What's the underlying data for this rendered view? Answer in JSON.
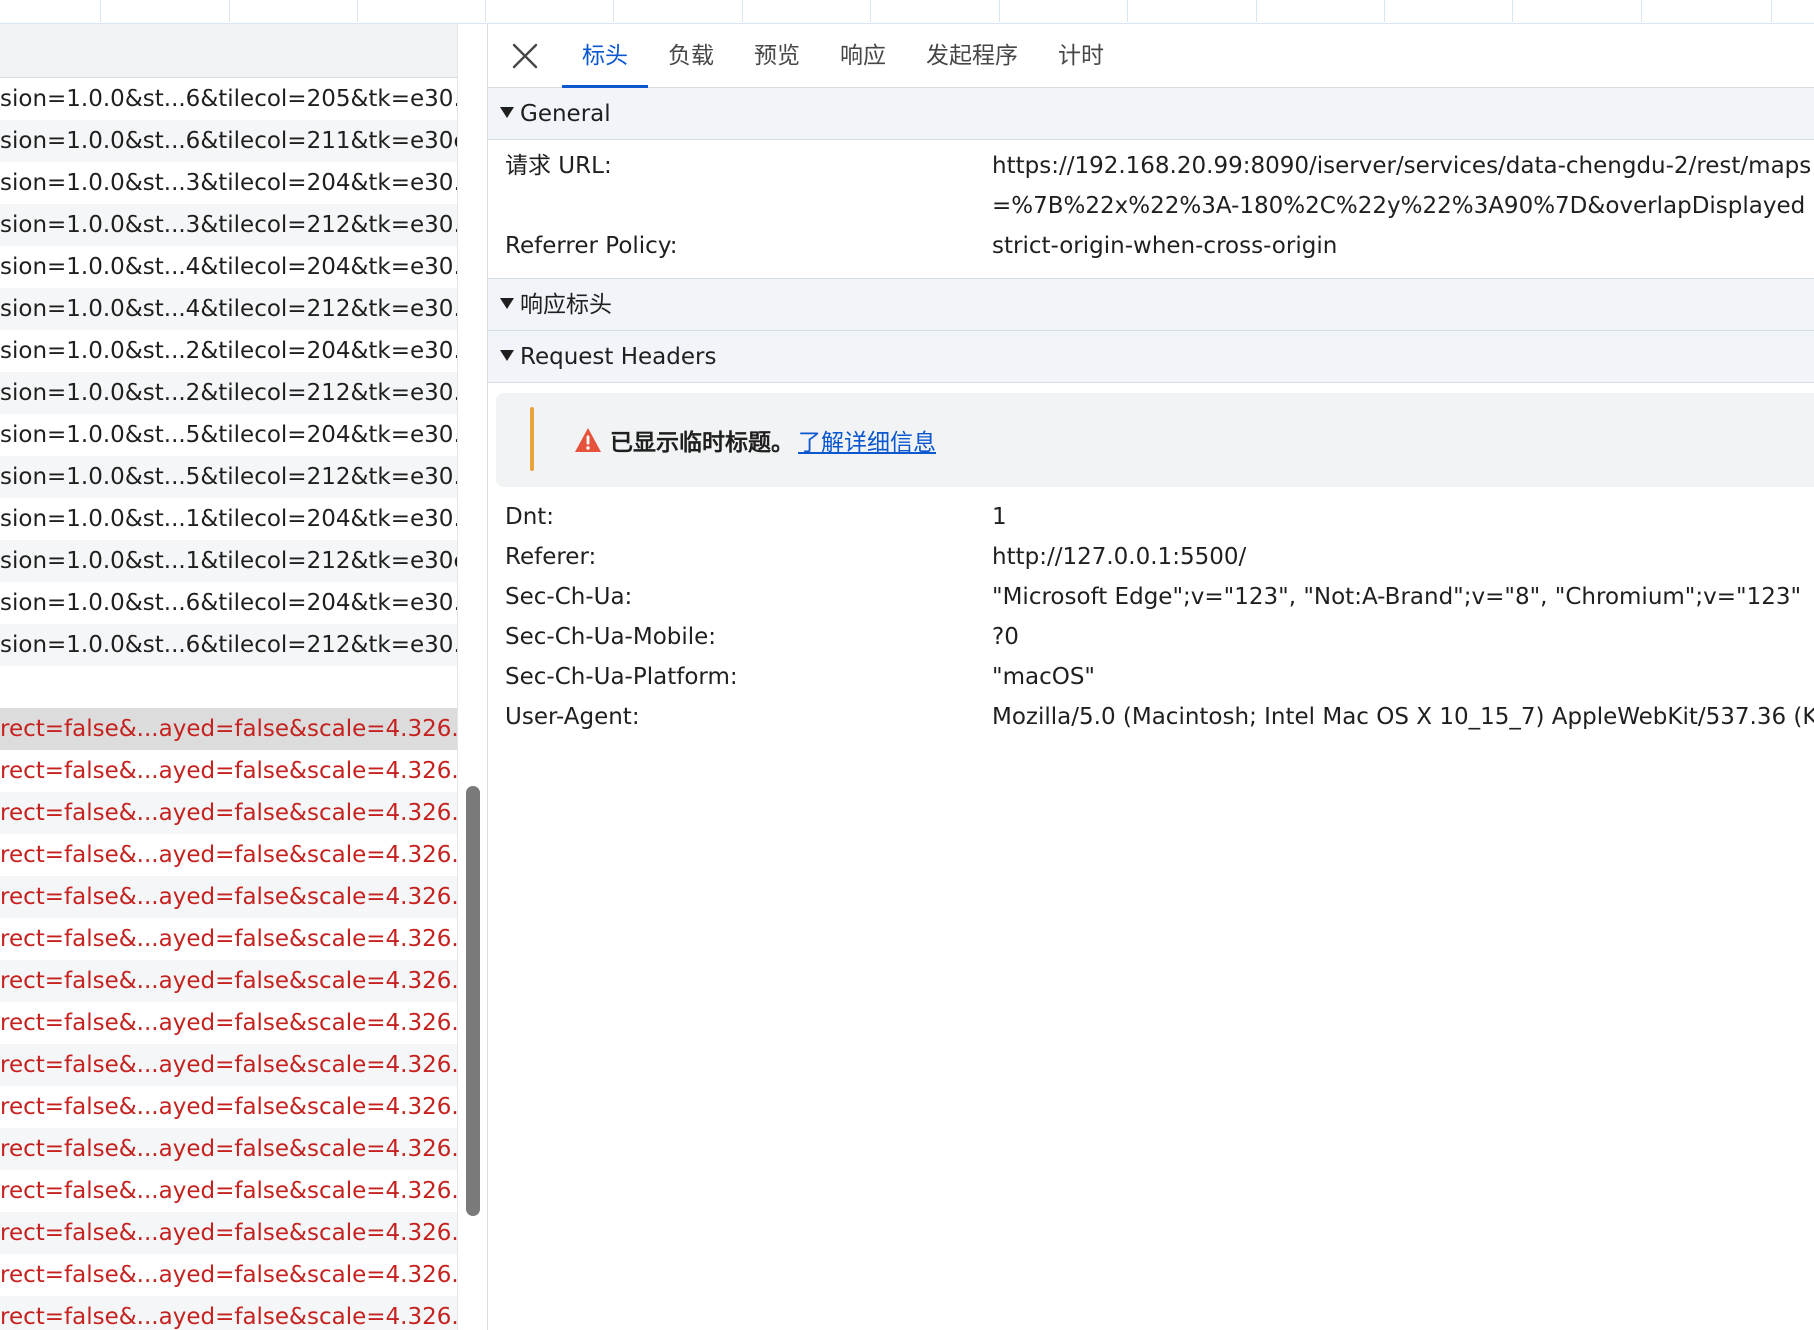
{
  "request_list": {
    "rows": [
      {
        "text": "sion=1.0.0&st...6&tilecol=205&tk=e30...",
        "error": false
      },
      {
        "text": "sion=1.0.0&st...6&tilecol=211&tk=e30c...",
        "error": false
      },
      {
        "text": "sion=1.0.0&st...3&tilecol=204&tk=e30...",
        "error": false
      },
      {
        "text": "sion=1.0.0&st...3&tilecol=212&tk=e30...",
        "error": false
      },
      {
        "text": "sion=1.0.0&st...4&tilecol=204&tk=e30...",
        "error": false
      },
      {
        "text": "sion=1.0.0&st...4&tilecol=212&tk=e30...",
        "error": false
      },
      {
        "text": "sion=1.0.0&st...2&tilecol=204&tk=e30...",
        "error": false
      },
      {
        "text": "sion=1.0.0&st...2&tilecol=212&tk=e30...",
        "error": false
      },
      {
        "text": "sion=1.0.0&st...5&tilecol=204&tk=e30...",
        "error": false
      },
      {
        "text": "sion=1.0.0&st...5&tilecol=212&tk=e30...",
        "error": false
      },
      {
        "text": "sion=1.0.0&st...1&tilecol=204&tk=e30...",
        "error": false
      },
      {
        "text": "sion=1.0.0&st...1&tilecol=212&tk=e30c...",
        "error": false
      },
      {
        "text": "sion=1.0.0&st...6&tilecol=204&tk=e30...",
        "error": false
      },
      {
        "text": "sion=1.0.0&st...6&tilecol=212&tk=e30...",
        "error": false
      },
      {
        "text": "",
        "error": false
      },
      {
        "text": "rect=false&...ayed=false&scale=4.326...",
        "error": true,
        "selected": true
      },
      {
        "text": "rect=false&...ayed=false&scale=4.326...",
        "error": true
      },
      {
        "text": "rect=false&...ayed=false&scale=4.326...",
        "error": true
      },
      {
        "text": "rect=false&...ayed=false&scale=4.326...",
        "error": true
      },
      {
        "text": "rect=false&...ayed=false&scale=4.326...",
        "error": true
      },
      {
        "text": "rect=false&...ayed=false&scale=4.326...",
        "error": true
      },
      {
        "text": "rect=false&...ayed=false&scale=4.326...",
        "error": true
      },
      {
        "text": "rect=false&...ayed=false&scale=4.326...",
        "error": true
      },
      {
        "text": "rect=false&...ayed=false&scale=4.326...",
        "error": true
      },
      {
        "text": "rect=false&...ayed=false&scale=4.326...",
        "error": true
      },
      {
        "text": "rect=false&...ayed=false&scale=4.326...",
        "error": true
      },
      {
        "text": "rect=false&...ayed=false&scale=4.326...",
        "error": true
      },
      {
        "text": "rect=false&...ayed=false&scale=4.326...",
        "error": true
      },
      {
        "text": "rect=false&...ayed=false&scale=4.326...",
        "error": true
      },
      {
        "text": "rect=false&...ayed=false&scale=4.326...",
        "error": true
      }
    ]
  },
  "tabs": [
    {
      "label": "标头",
      "active": true
    },
    {
      "label": "负载",
      "active": false
    },
    {
      "label": "预览",
      "active": false
    },
    {
      "label": "响应",
      "active": false
    },
    {
      "label": "发起程序",
      "active": false
    },
    {
      "label": "计时",
      "active": false
    }
  ],
  "general": {
    "title": "General",
    "request_url_label": "请求 URL:",
    "request_url_line1": "https://192.168.20.99:8090/iserver/services/data-chengdu-2/rest/maps",
    "request_url_line2": "=%7B%22x%22%3A-180%2C%22y%22%3A90%7D&overlapDisplayed",
    "referrer_policy_label": "Referrer Policy:",
    "referrer_policy_value": "strict-origin-when-cross-origin"
  },
  "response_headers": {
    "title": "响应标头"
  },
  "request_headers": {
    "title": "Request Headers",
    "notice_text": "已显示临时标题。",
    "notice_link": "了解详细信息",
    "items": [
      {
        "key": "Dnt:",
        "value": "1"
      },
      {
        "key": "Referer:",
        "value": "http://127.0.0.1:5500/"
      },
      {
        "key": "Sec-Ch-Ua:",
        "value": "\"Microsoft Edge\";v=\"123\", \"Not:A-Brand\";v=\"8\", \"Chromium\";v=\"123\""
      },
      {
        "key": "Sec-Ch-Ua-Mobile:",
        "value": "?0"
      },
      {
        "key": "Sec-Ch-Ua-Platform:",
        "value": "\"macOS\""
      },
      {
        "key": "User-Agent:",
        "value": "Mozilla/5.0 (Macintosh; Intel Mac OS X 10_15_7) AppleWebKit/537.36 (K"
      }
    ]
  },
  "colors": {
    "accent": "#0b57d0",
    "error_text": "#c5221f",
    "warning": "#e8a33d",
    "warning_icon": "#e5533c"
  },
  "icons": {
    "close": "close-icon",
    "warning": "warning-icon",
    "disclosure": "triangle-down-icon"
  }
}
